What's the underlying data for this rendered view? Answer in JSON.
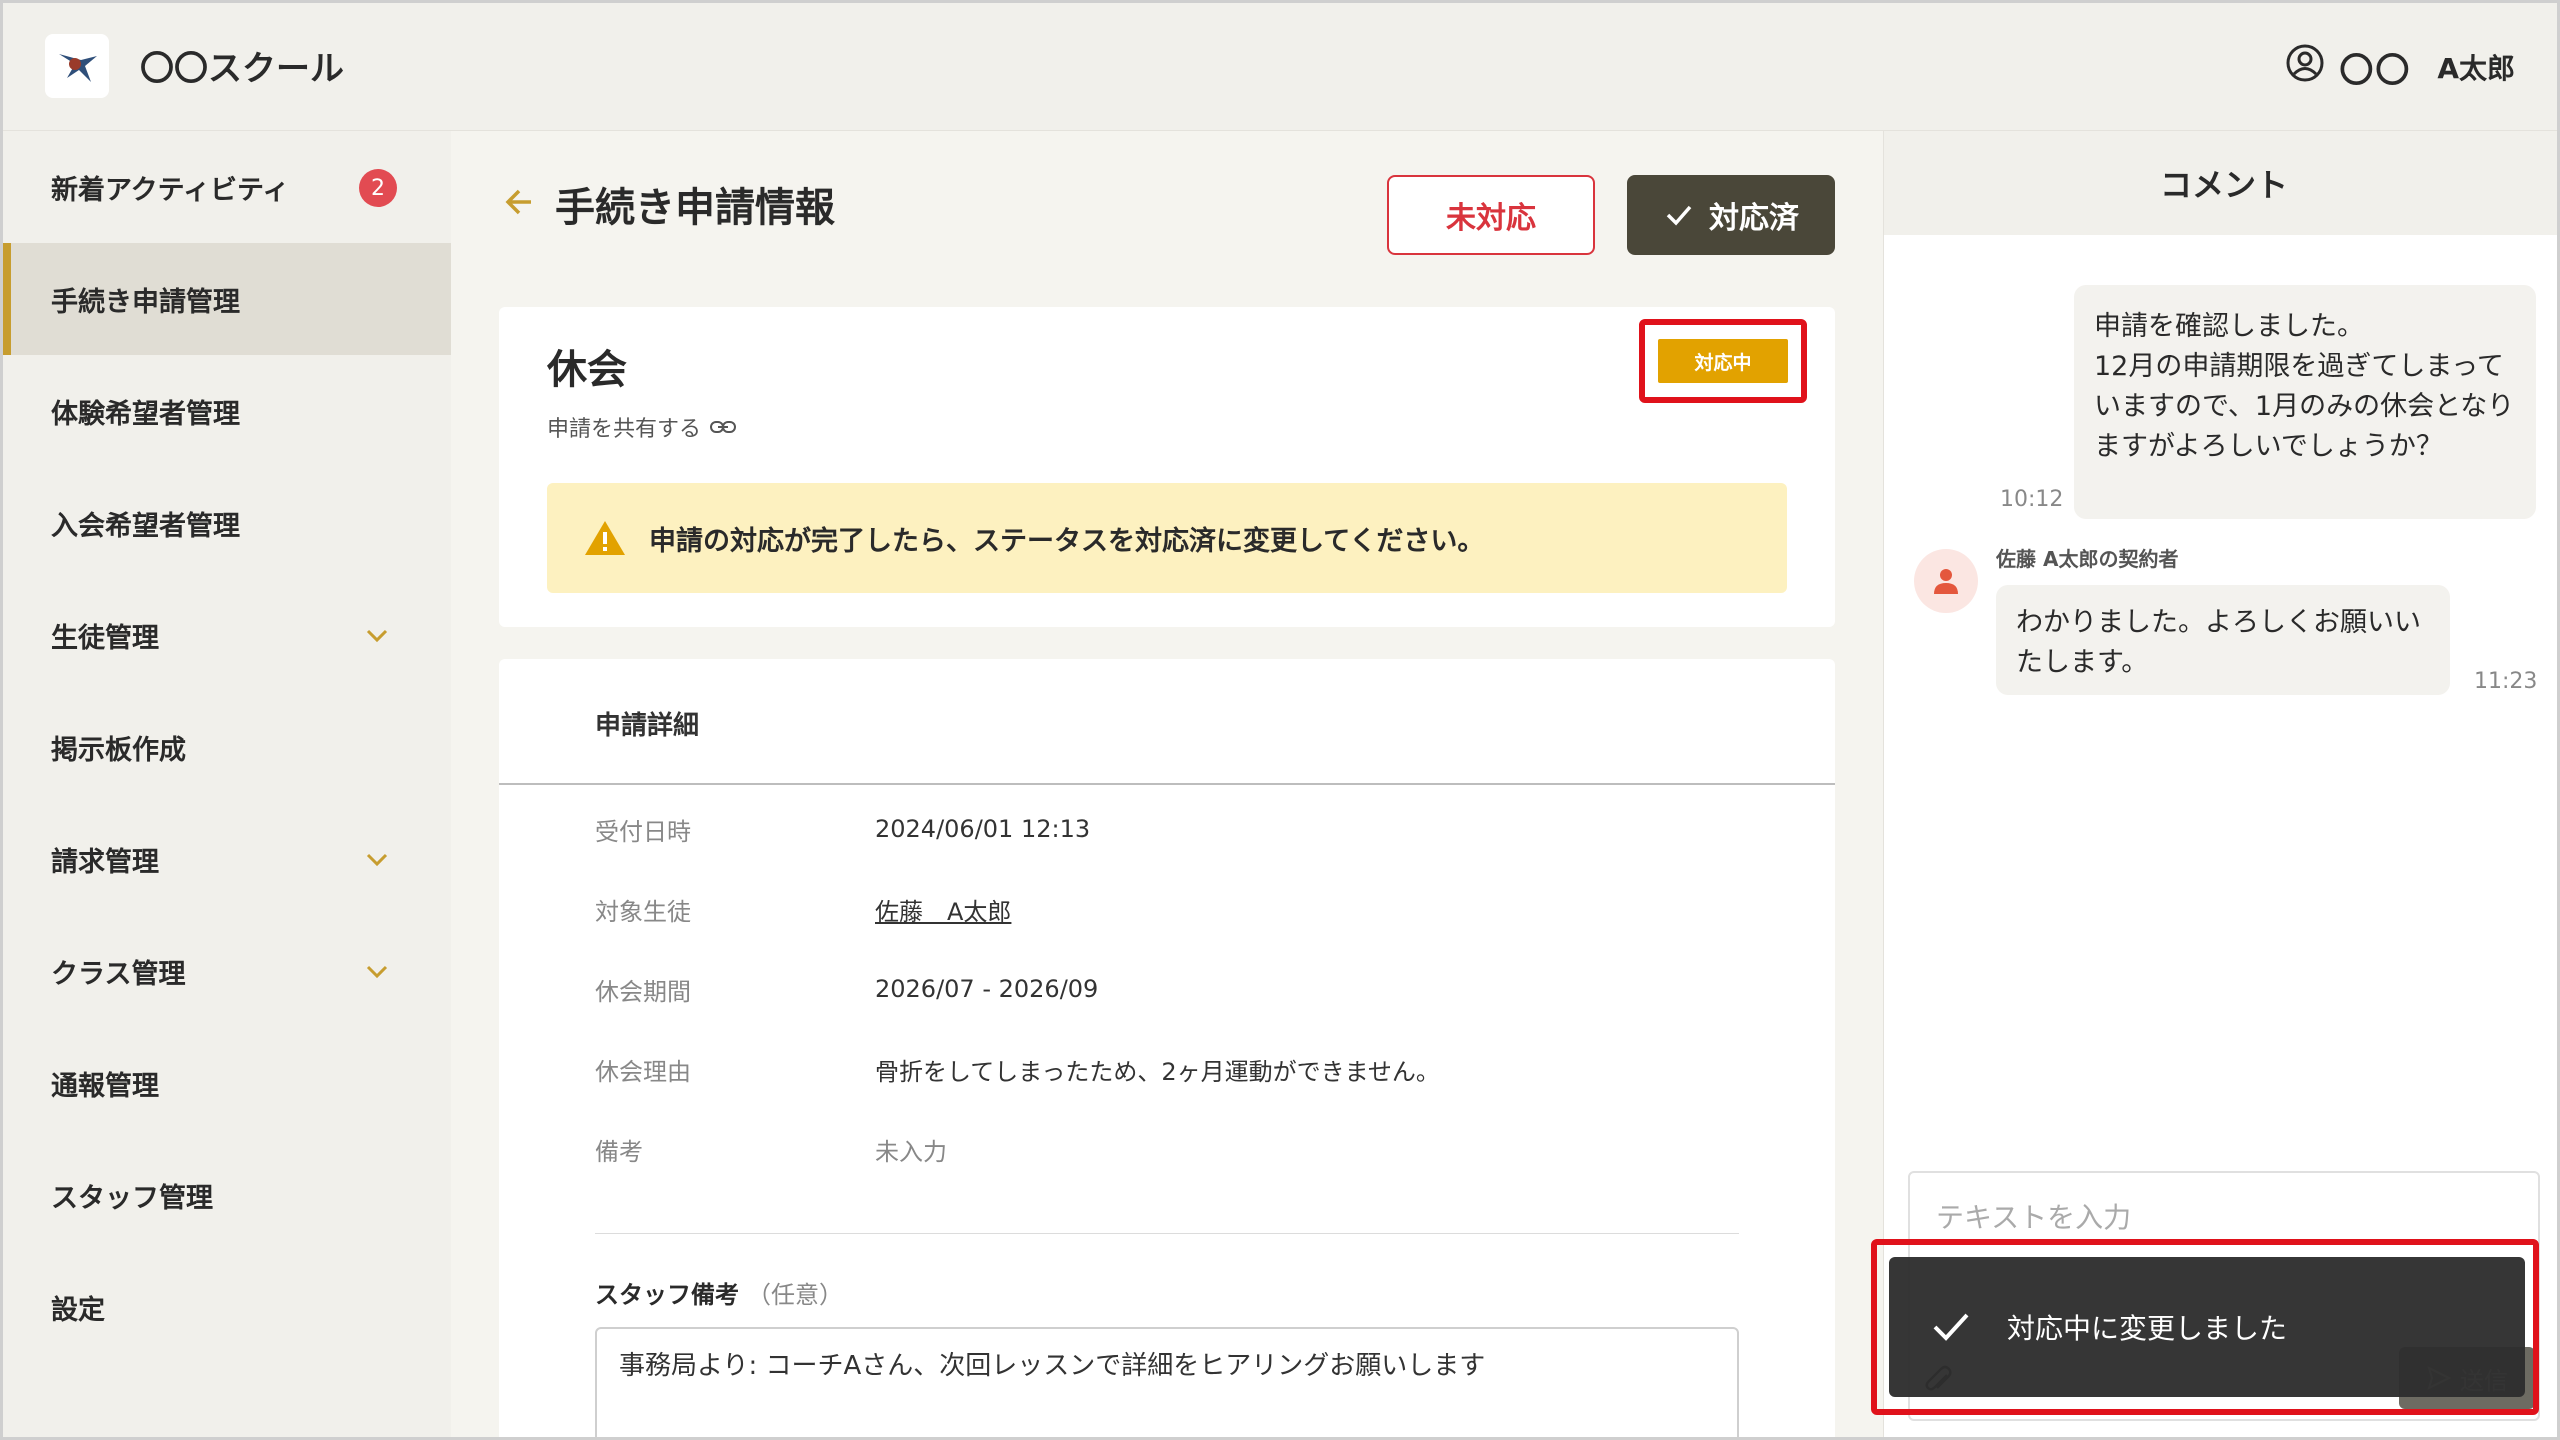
{
  "header": {
    "school_name": "〇〇スクール",
    "user_org": "〇〇",
    "user_name": "A太郎"
  },
  "sidebar": {
    "items": [
      {
        "label": "新着アクティビティ",
        "badge": "2"
      },
      {
        "label": "手続き申請管理",
        "active": true
      },
      {
        "label": "体験希望者管理"
      },
      {
        "label": "入会希望者管理"
      },
      {
        "label": "生徒管理",
        "expandable": true
      },
      {
        "label": "掲示板作成"
      },
      {
        "label": "請求管理",
        "expandable": true
      },
      {
        "label": "クラス管理",
        "expandable": true
      },
      {
        "label": "通報管理"
      },
      {
        "label": "スタッフ管理"
      },
      {
        "label": "設定"
      }
    ]
  },
  "main": {
    "page_title": "手続き申請情報",
    "btn_pending": "未対応",
    "btn_done": "対応済",
    "request_type": "休会",
    "share_label": "申請を共有する",
    "status": "対応中",
    "notice": "申請の対応が完了したら、ステータスを対応済に変更してください。",
    "details_title": "申請詳細",
    "details": [
      {
        "label": "受付日時",
        "value": "2024/06/01 12:13"
      },
      {
        "label": "対象生徒",
        "value": "佐藤　A太郎"
      },
      {
        "label": "休会期間",
        "value": "2026/07 - 2026/09"
      },
      {
        "label": "休会理由",
        "value": "骨折をしてしまったため、2ヶ月運動ができません。"
      },
      {
        "label": "備考",
        "value": "未入力"
      }
    ],
    "staff_note_label": "スタッフ備考",
    "staff_note_optional": "（任意）",
    "staff_note_value": "事務局より: コーチAさん、次回レッスンで詳細をヒアリングお願いします"
  },
  "comments": {
    "title": "コメント",
    "messages": [
      {
        "text": "申請を確認しました。\n12月の申請期限を過ぎてしまっていますので、1月のみの休会となりますがよろしいでしょうか？",
        "time": "10:12"
      },
      {
        "sender": "佐藤 A太郎の契約者",
        "text": "わかりました。よろしくお願いいたします。",
        "time": "11:23"
      }
    ],
    "input_placeholder": "テキストを入力",
    "send_label": "送信"
  },
  "toast": {
    "message": "対応中に変更しました"
  },
  "colors": {
    "accent": "#c79d2f",
    "status_in_progress": "#e2a200",
    "danger": "#d9343d",
    "done_button": "#4a4739"
  }
}
